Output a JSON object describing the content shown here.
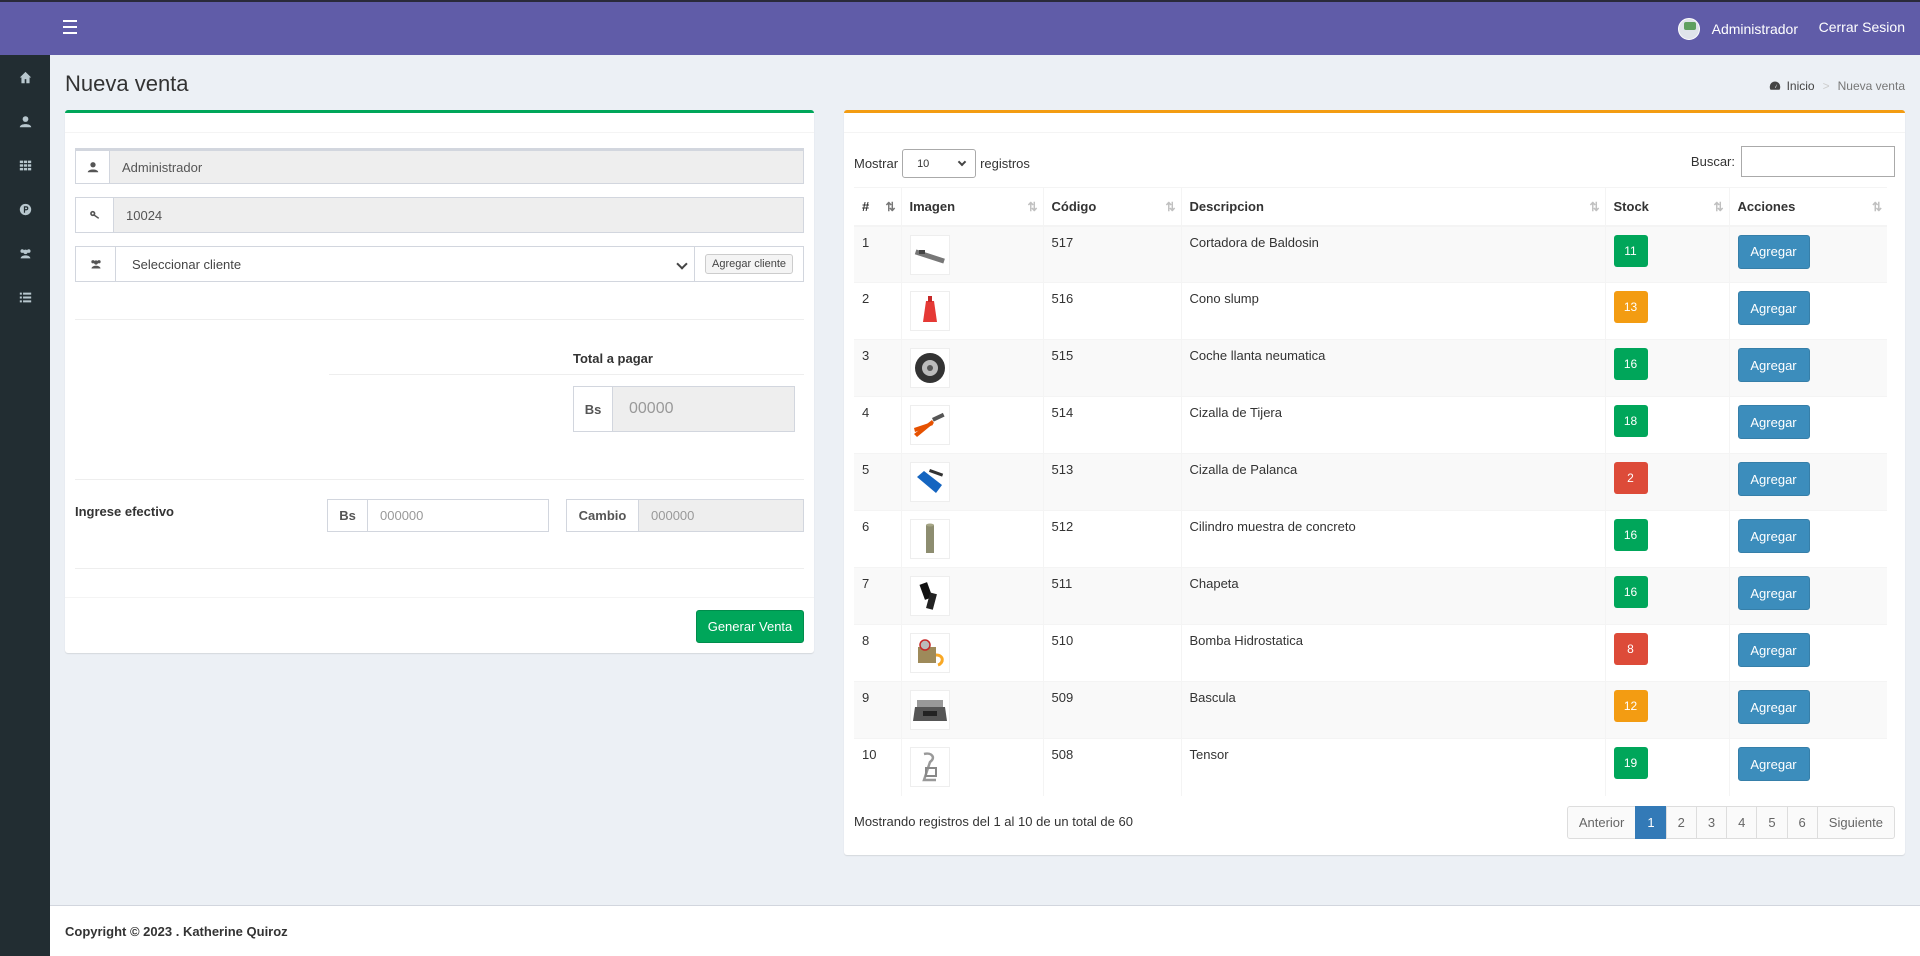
{
  "header": {
    "user_name": "Administrador",
    "logout_label": "Cerrar Sesion",
    "color": "#605ca8"
  },
  "sidebar": {
    "items": [
      {
        "icon": "home-icon"
      },
      {
        "icon": "user-icon"
      },
      {
        "icon": "grid-icon"
      },
      {
        "icon": "product-icon"
      },
      {
        "icon": "users-icon"
      },
      {
        "icon": "list-icon"
      }
    ]
  },
  "page": {
    "title": "Nueva venta",
    "breadcrumb_home": "Inicio",
    "breadcrumb_current": "Nueva venta"
  },
  "sale_form": {
    "seller": "Administrador",
    "code": "10024",
    "client_placeholder": "Seleccionar cliente",
    "add_client_label": "Agregar cliente",
    "total_label": "Total a pagar",
    "currency": "Bs",
    "total_placeholder": "00000",
    "cash_label": "Ingrese efectivo",
    "cash_placeholder": "000000",
    "change_label": "Cambio",
    "change_placeholder": "000000",
    "generate_label": "Generar Venta"
  },
  "products_table": {
    "show_label": "Mostrar",
    "show_value": "10",
    "records_label": "registros",
    "search_label": "Buscar:",
    "columns": [
      "#",
      "Imagen",
      "Código",
      "Descripcion",
      "Stock",
      "Acciones"
    ],
    "action_label": "Agregar",
    "rows": [
      {
        "num": "1",
        "code": "517",
        "desc": "Cortadora de Baldosin",
        "stock": "11",
        "stock_color": "#00a65a",
        "image": "tile-cutter-icon"
      },
      {
        "num": "2",
        "code": "516",
        "desc": "Cono slump",
        "stock": "13",
        "stock_color": "#f39c12",
        "image": "slump-cone-icon"
      },
      {
        "num": "3",
        "code": "515",
        "desc": "Coche llanta neumatica",
        "stock": "16",
        "stock_color": "#00a65a",
        "image": "tire-icon"
      },
      {
        "num": "4",
        "code": "514",
        "desc": "Cizalla de Tijera",
        "stock": "18",
        "stock_color": "#00a65a",
        "image": "shears-icon"
      },
      {
        "num": "5",
        "code": "513",
        "desc": "Cizalla de Palanca",
        "stock": "2",
        "stock_color": "#dd4b39",
        "image": "lever-shear-icon"
      },
      {
        "num": "6",
        "code": "512",
        "desc": "Cilindro muestra de concreto",
        "stock": "16",
        "stock_color": "#00a65a",
        "image": "cylinder-icon"
      },
      {
        "num": "7",
        "code": "511",
        "desc": "Chapeta",
        "stock": "16",
        "stock_color": "#00a65a",
        "image": "clamp-icon"
      },
      {
        "num": "8",
        "code": "510",
        "desc": "Bomba Hidrostatica",
        "stock": "8",
        "stock_color": "#dd4b39",
        "image": "pump-icon"
      },
      {
        "num": "9",
        "code": "509",
        "desc": "Bascula",
        "stock": "12",
        "stock_color": "#f39c12",
        "image": "scale-icon"
      },
      {
        "num": "10",
        "code": "508",
        "desc": "Tensor",
        "stock": "19",
        "stock_color": "#00a65a",
        "image": "tensor-icon"
      }
    ],
    "info": "Mostrando registros del 1 al 10 de un total de 60",
    "pagination": {
      "prev": "Anterior",
      "pages": [
        "1",
        "2",
        "3",
        "4",
        "5",
        "6"
      ],
      "current": "1",
      "next": "Siguiente"
    }
  },
  "footer": {
    "text": "Copyright © 2023 . Katherine Quiroz"
  }
}
